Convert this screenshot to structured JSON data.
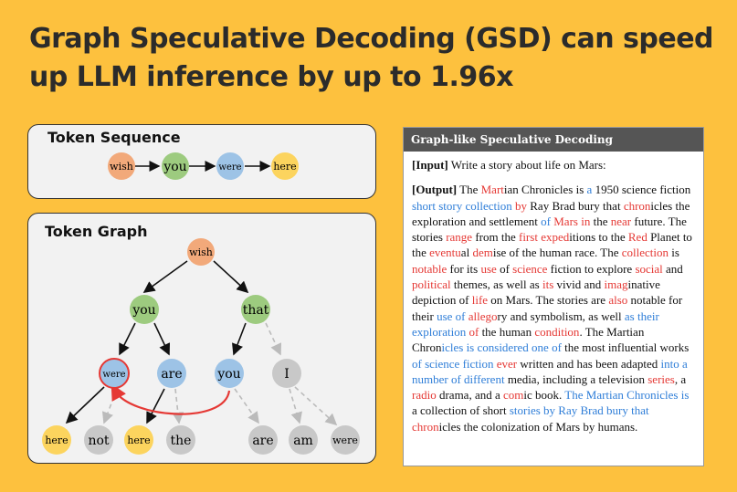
{
  "headline": "Graph Speculative Decoding (GSD) can speed up LLM inference by up to 1.96x",
  "sequence_panel": {
    "title": "Token Sequence",
    "nodes": [
      "wish",
      "you",
      "were",
      "here"
    ]
  },
  "graph_panel": {
    "title": "Token Graph",
    "nodes": {
      "root": "wish",
      "l1_left": "you",
      "l1_right": "that",
      "l2_were": "were",
      "l2_are": "are",
      "l2_you": "you",
      "l2_i": "I",
      "l3_here1": "here",
      "l3_not": "not",
      "l3_here2": "here",
      "l3_the": "the",
      "l3_are": "are",
      "l3_am": "am",
      "l3_were": "were"
    }
  },
  "colors": {
    "background": "#FDC13E",
    "orange_node": "#F2A97A",
    "green_node": "#9DCB7F",
    "blue_node": "#9DC3E6",
    "yellow_node": "#FCD45E",
    "gray_node": "#C8C8C8",
    "highlight": "#E53935",
    "blue_text": "#2F7ED8"
  },
  "text_panel": {
    "header": "Graph-like Speculative Decoding",
    "input_label": "[Input]",
    "input_text": "Write a story about life on Mars:",
    "output_label": "[Output]",
    "output_segments": [
      {
        "t": "The ",
        "c": ""
      },
      {
        "t": "Mart",
        "c": "r"
      },
      {
        "t": "ian Chronicles is ",
        "c": ""
      },
      {
        "t": "a",
        "c": "b"
      },
      {
        "t": " 1950 science fiction ",
        "c": ""
      },
      {
        "t": "short story collection",
        "c": "b"
      },
      {
        "t": " ",
        "c": ""
      },
      {
        "t": "by",
        "c": "r"
      },
      {
        "t": " Ray Brad bury that ",
        "c": ""
      },
      {
        "t": "chron",
        "c": "r"
      },
      {
        "t": "icles the exploration and settlement ",
        "c": ""
      },
      {
        "t": "of",
        "c": "b"
      },
      {
        "t": " ",
        "c": ""
      },
      {
        "t": "Mars in",
        "c": "r"
      },
      {
        "t": " the ",
        "c": ""
      },
      {
        "t": "near",
        "c": "r"
      },
      {
        "t": " future. The stories ",
        "c": ""
      },
      {
        "t": "range",
        "c": "r"
      },
      {
        "t": " from the ",
        "c": ""
      },
      {
        "t": "first",
        "c": "r"
      },
      {
        "t": " ",
        "c": ""
      },
      {
        "t": "exped",
        "c": "r"
      },
      {
        "t": "itions to the ",
        "c": ""
      },
      {
        "t": "Red",
        "c": "r"
      },
      {
        "t": " Planet to the ",
        "c": ""
      },
      {
        "t": "eventu",
        "c": "r"
      },
      {
        "t": "al ",
        "c": ""
      },
      {
        "t": "dem",
        "c": "r"
      },
      {
        "t": "ise of the human race. The ",
        "c": ""
      },
      {
        "t": "collection",
        "c": "r"
      },
      {
        "t": " is ",
        "c": ""
      },
      {
        "t": "notable",
        "c": "r"
      },
      {
        "t": " for its ",
        "c": ""
      },
      {
        "t": "use",
        "c": "r"
      },
      {
        "t": " of ",
        "c": ""
      },
      {
        "t": "science",
        "c": "r"
      },
      {
        "t": " fiction to explore ",
        "c": ""
      },
      {
        "t": "social",
        "c": "r"
      },
      {
        "t": " and ",
        "c": ""
      },
      {
        "t": "political",
        "c": "r"
      },
      {
        "t": " themes, as well as ",
        "c": ""
      },
      {
        "t": "its",
        "c": "r"
      },
      {
        "t": " vivid and ",
        "c": ""
      },
      {
        "t": "imag",
        "c": "r"
      },
      {
        "t": "inative depiction of ",
        "c": ""
      },
      {
        "t": "life",
        "c": "r"
      },
      {
        "t": " on Mars. The stories are ",
        "c": ""
      },
      {
        "t": "also",
        "c": "r"
      },
      {
        "t": " notable for their ",
        "c": ""
      },
      {
        "t": "use of",
        "c": "b"
      },
      {
        "t": " ",
        "c": ""
      },
      {
        "t": "allego",
        "c": "r"
      },
      {
        "t": "ry and symbolism, as well ",
        "c": ""
      },
      {
        "t": "as their exploration",
        "c": "b"
      },
      {
        "t": " ",
        "c": ""
      },
      {
        "t": "of",
        "c": "r"
      },
      {
        "t": " the human ",
        "c": ""
      },
      {
        "t": "condition",
        "c": "r"
      },
      {
        "t": ". The Martian Chron",
        "c": ""
      },
      {
        "t": "icles is considered one of",
        "c": "b"
      },
      {
        "t": " the most influential works ",
        "c": ""
      },
      {
        "t": "of science fiction",
        "c": "b"
      },
      {
        "t": " ",
        "c": ""
      },
      {
        "t": "ever",
        "c": "r"
      },
      {
        "t": " written and has been adapted ",
        "c": ""
      },
      {
        "t": "into a number of different",
        "c": "b"
      },
      {
        "t": " media, including a television ",
        "c": ""
      },
      {
        "t": "series",
        "c": "r"
      },
      {
        "t": ", a ",
        "c": ""
      },
      {
        "t": "radio",
        "c": "r"
      },
      {
        "t": " drama, and a ",
        "c": ""
      },
      {
        "t": "com",
        "c": "r"
      },
      {
        "t": "ic book. ",
        "c": ""
      },
      {
        "t": "The Martian Chronicles is",
        "c": "b"
      },
      {
        "t": " a collection of short ",
        "c": ""
      },
      {
        "t": "stories by Ray Brad bury that",
        "c": "b"
      },
      {
        "t": " ",
        "c": ""
      },
      {
        "t": "chron",
        "c": "r"
      },
      {
        "t": "icles the colonization of Mars by humans.",
        "c": ""
      }
    ]
  }
}
